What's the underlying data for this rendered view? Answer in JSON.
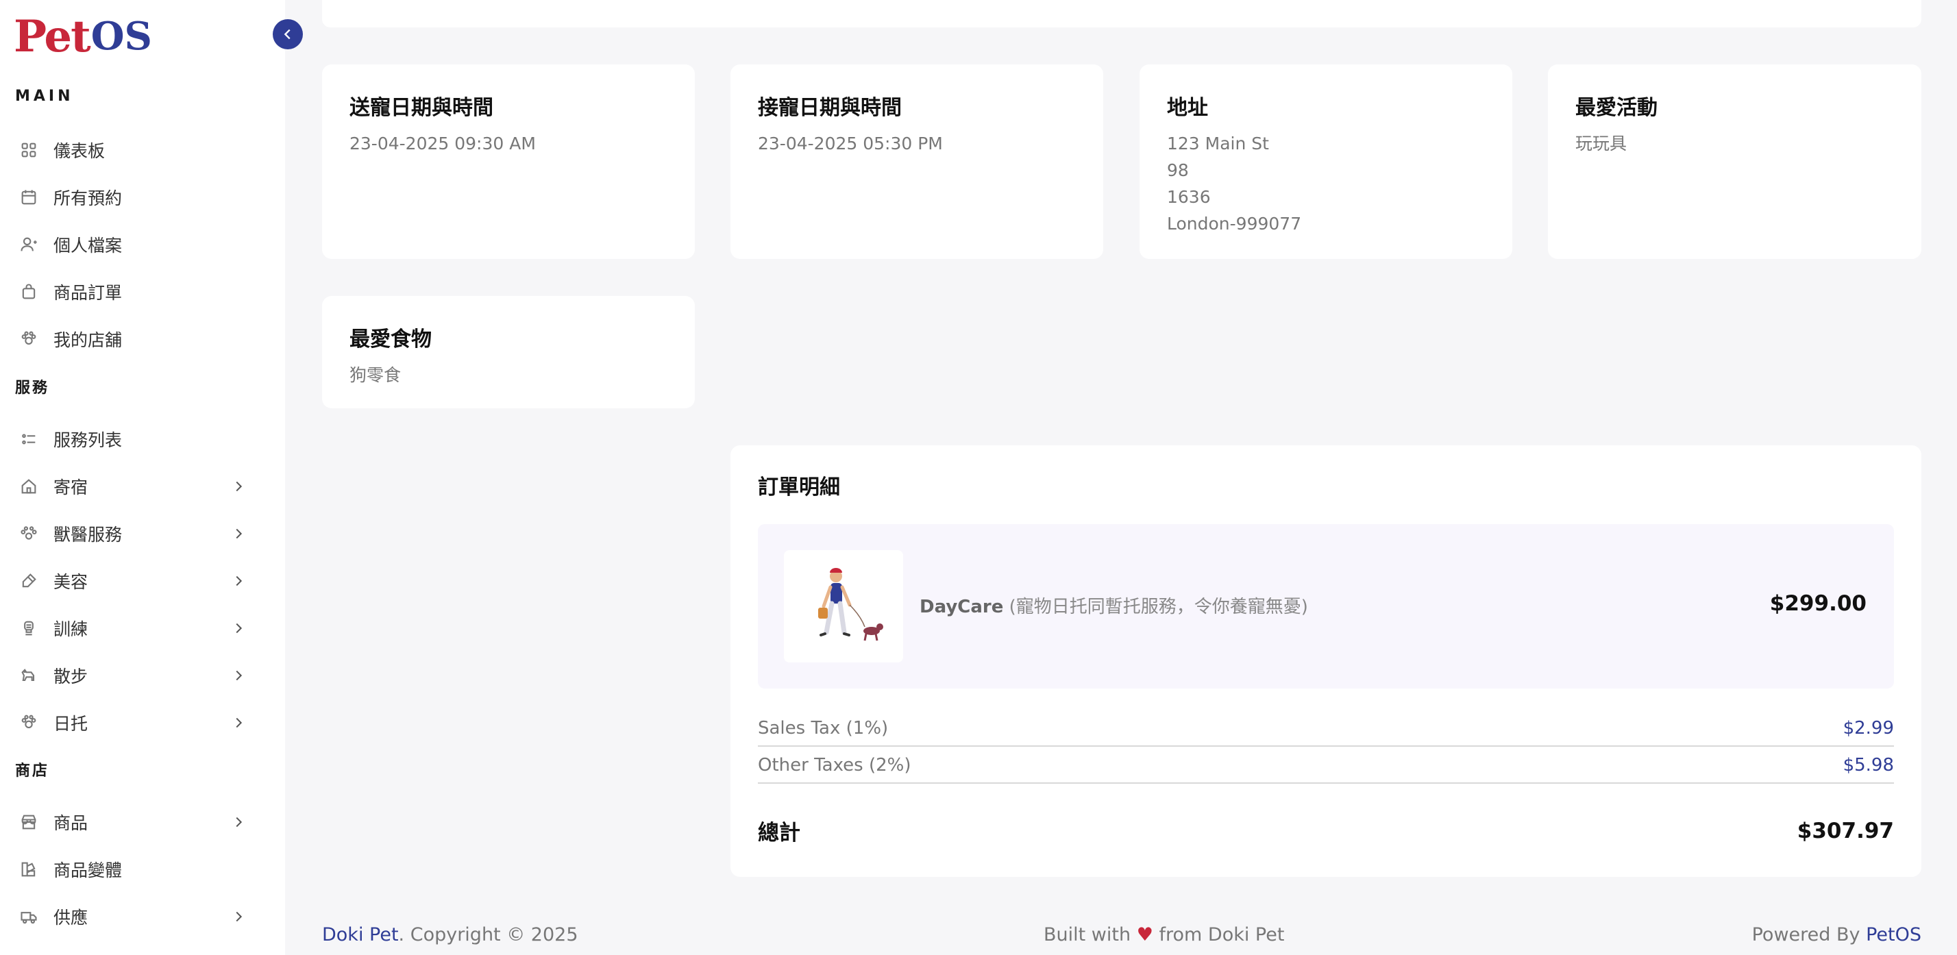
{
  "sidebar": {
    "logo": {
      "part1": "Pet",
      "part2": "OS"
    },
    "sections": {
      "main": "MAIN",
      "services": "服務",
      "store": "商店"
    },
    "items": [
      {
        "label": "儀表板",
        "icon": "dashboard-icon"
      },
      {
        "label": "所有預約",
        "icon": "calendar-icon"
      },
      {
        "label": "個人檔案",
        "icon": "user-icon"
      },
      {
        "label": "商品訂單",
        "icon": "bag-icon"
      },
      {
        "label": "我的店舖",
        "icon": "paw-icon"
      },
      {
        "label": "服務列表",
        "icon": "list-icon"
      },
      {
        "label": "寄宿",
        "icon": "home-icon"
      },
      {
        "label": "獸醫服務",
        "icon": "paws-icon"
      },
      {
        "label": "美容",
        "icon": "brush-icon"
      },
      {
        "label": "訓練",
        "icon": "trophy-icon"
      },
      {
        "label": "散步",
        "icon": "dog-icon"
      },
      {
        "label": "日托",
        "icon": "paw-icon"
      },
      {
        "label": "商品",
        "icon": "store-icon"
      },
      {
        "label": "商品變體",
        "icon": "variants-icon"
      },
      {
        "label": "供應",
        "icon": "truck-icon"
      }
    ]
  },
  "cards": {
    "dropoff": {
      "title": "送寵日期與時間",
      "value": "23-04-2025 09:30 AM"
    },
    "pickup": {
      "title": "接寵日期與時間",
      "value": "23-04-2025 05:30 PM"
    },
    "address": {
      "title": "地址",
      "line1": "123 Main St",
      "line2": "98",
      "line3": "1636",
      "line4": "London-999077"
    },
    "activity": {
      "title": "最愛活動",
      "value": "玩玩具"
    },
    "food": {
      "title": "最愛食物",
      "value": "狗零食"
    }
  },
  "order": {
    "title": "訂單明細",
    "item": {
      "name": "DayCare",
      "desc": " (寵物日托同暫托服務，令你養寵無憂)",
      "price": "$299.00"
    },
    "taxes": [
      {
        "label": "Sales Tax (1%)",
        "value": "$2.99"
      },
      {
        "label": "Other Taxes (2%)",
        "value": "$5.98"
      }
    ],
    "total_label": "總計",
    "total_value": "$307.97"
  },
  "footer": {
    "brand": "Doki Pet",
    "copyright": ". Copyright © 2025",
    "built_prefix": "Built with ",
    "heart": "♥",
    "built_suffix": " from Doki Pet",
    "powered_prefix": "Powered By ",
    "powered_brand": "PetOS"
  },
  "colors": {
    "accent": "#2f3d96",
    "brand_red": "#c8273a"
  }
}
